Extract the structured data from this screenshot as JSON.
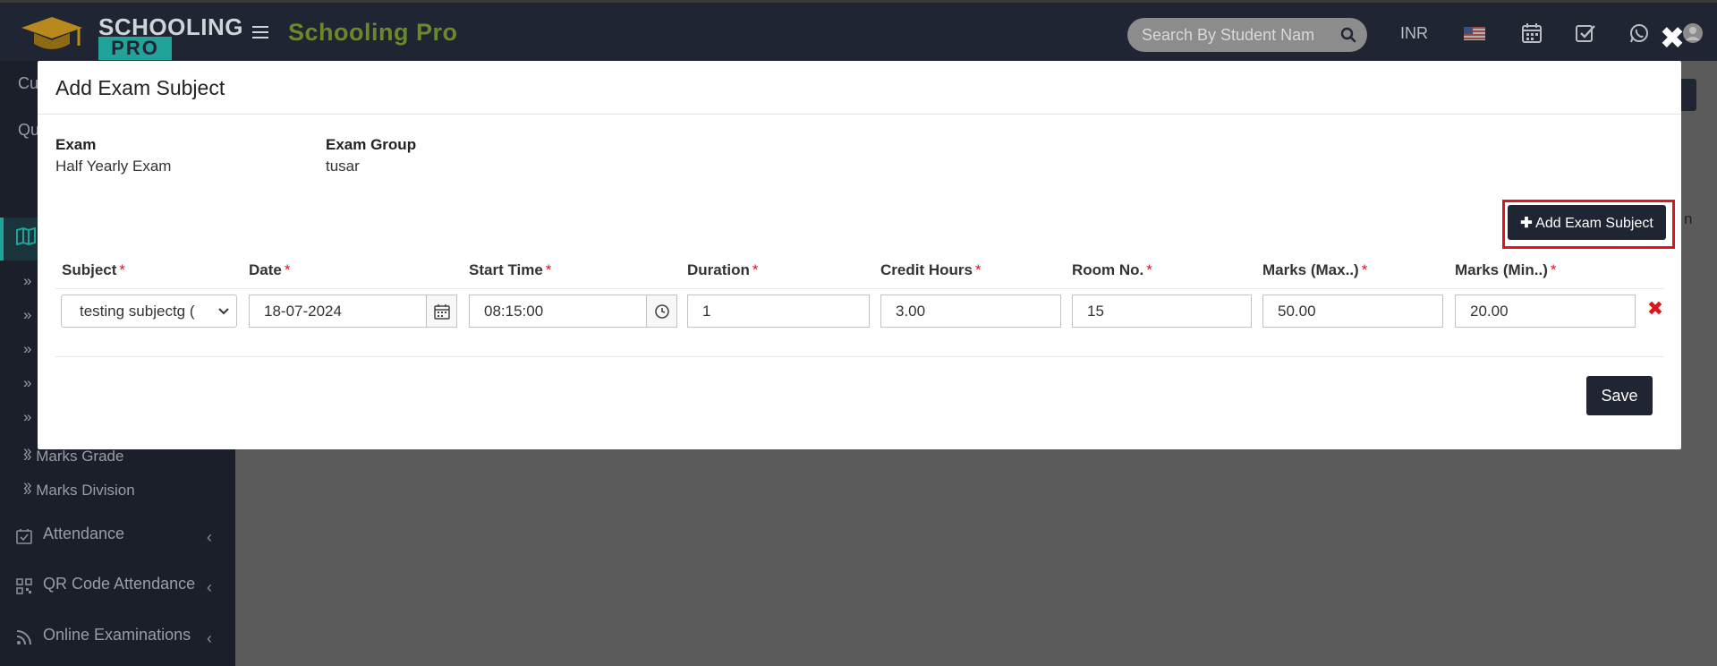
{
  "app": {
    "logo_line1": "SCHOOLING",
    "logo_line2": "PRO",
    "brand": "Schooling Pro",
    "search_placeholder": "Search By Student Nam",
    "currency": "INR",
    "close_symbol": "✖"
  },
  "sidebar": {
    "partial_items": [
      "Cu",
      "Qu"
    ],
    "sub_items": [
      "Marks Grade",
      "Marks Division"
    ],
    "items": [
      {
        "label": "Attendance",
        "icon": "calendar-check-icon"
      },
      {
        "label": "QR Code Attendance",
        "icon": "qrcode-icon"
      },
      {
        "label": "Online Examinations",
        "icon": "rss-icon"
      }
    ],
    "chevron": "‹",
    "sub_prefix": "»",
    "bg_partial_text": "n"
  },
  "modal": {
    "title": "Add Exam Subject",
    "exam_label": "Exam",
    "exam_value": "Half Yearly Exam",
    "group_label": "Exam Group",
    "group_value": "tusar",
    "add_button": "Add Exam Subject",
    "save_button": "Save",
    "required_mark": "*",
    "columns": [
      "Subject",
      "Date",
      "Start Time",
      "Duration",
      "Credit Hours",
      "Room No.",
      "Marks (Max..)",
      "Marks (Min..)"
    ],
    "row": {
      "subject": "testing subjectg (",
      "date": "18-07-2024",
      "start_time": "08:15:00",
      "duration": "1",
      "credit_hours": "3.00",
      "room_no": "15",
      "marks_max": "50.00",
      "marks_min": "20.00"
    },
    "delete_symbol": "✖"
  },
  "colors": {
    "topbar": "#1f2533",
    "accent": "#22a39a",
    "brand": "#6a8a2a",
    "required": "#e0141d",
    "button": "#1f2533"
  }
}
